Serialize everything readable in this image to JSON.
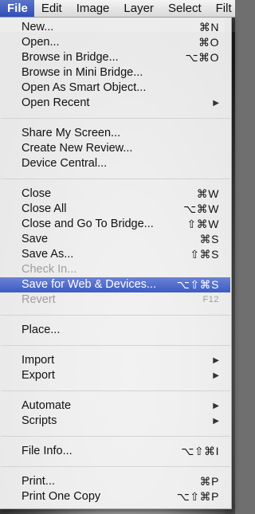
{
  "menubar": {
    "items": [
      "File",
      "Edit",
      "Image",
      "Layer",
      "Select",
      "Filt"
    ]
  },
  "menu": {
    "items": [
      {
        "label": "New...",
        "shortcut": "⌘N"
      },
      {
        "label": "Open...",
        "shortcut": "⌘O"
      },
      {
        "label": "Browse in Bridge...",
        "shortcut": "⌥⌘O"
      },
      {
        "label": "Browse in Mini Bridge...",
        "shortcut": ""
      },
      {
        "label": "Open As Smart Object...",
        "shortcut": ""
      },
      {
        "label": "Open Recent",
        "shortcut": "",
        "submenu": true
      },
      {
        "label": "Share My Screen...",
        "shortcut": ""
      },
      {
        "label": "Create New Review...",
        "shortcut": ""
      },
      {
        "label": "Device Central...",
        "shortcut": ""
      },
      {
        "label": "Close",
        "shortcut": "⌘W"
      },
      {
        "label": "Close All",
        "shortcut": "⌥⌘W"
      },
      {
        "label": "Close and Go To Bridge...",
        "shortcut": "⇧⌘W"
      },
      {
        "label": "Save",
        "shortcut": "⌘S"
      },
      {
        "label": "Save As...",
        "shortcut": "⇧⌘S"
      },
      {
        "label": "Check In...",
        "shortcut": "",
        "disabled": true
      },
      {
        "label": "Save for Web & Devices...",
        "shortcut": "⌥⇧⌘S",
        "highlighted": true
      },
      {
        "label": "Revert",
        "shortcut": "F12",
        "disabled": true
      },
      {
        "label": "Place...",
        "shortcut": ""
      },
      {
        "label": "Import",
        "shortcut": "",
        "submenu": true
      },
      {
        "label": "Export",
        "shortcut": "",
        "submenu": true
      },
      {
        "label": "Automate",
        "shortcut": "",
        "submenu": true
      },
      {
        "label": "Scripts",
        "shortcut": "",
        "submenu": true
      },
      {
        "label": "File Info...",
        "shortcut": "⌥⇧⌘I"
      },
      {
        "label": "Print...",
        "shortcut": "⌘P"
      },
      {
        "label": "Print One Copy",
        "shortcut": "⌥⇧⌘P"
      }
    ]
  },
  "colors": {
    "highlight": "#3c5cc4",
    "disabled_text": "#9e9e9e"
  },
  "icons": {
    "submenu": "triangle-right"
  }
}
